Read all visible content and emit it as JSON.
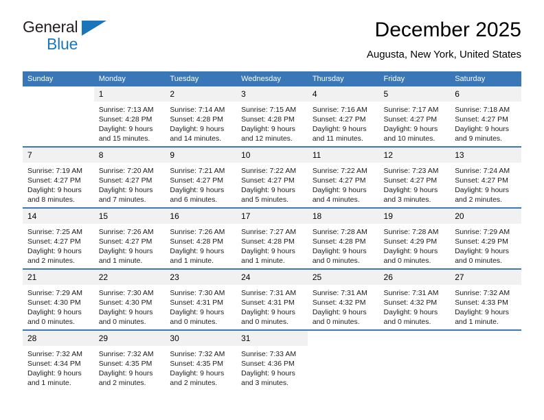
{
  "brand": {
    "line1": "General",
    "line2": "Blue",
    "triangle_color": "#1b75bb"
  },
  "header": {
    "title": "December 2025",
    "subtitle": "Augusta, New York, United States"
  },
  "theme": {
    "header_blue": "#3a77b8",
    "daynum_band": "#f1f1f1",
    "text": "#000000"
  },
  "calendar": {
    "weekday_headers": [
      "Sunday",
      "Monday",
      "Tuesday",
      "Wednesday",
      "Thursday",
      "Friday",
      "Saturday"
    ],
    "weeks": [
      [
        {
          "day": "",
          "lines": []
        },
        {
          "day": "1",
          "lines": [
            "Sunrise: 7:13 AM",
            "Sunset: 4:28 PM",
            "Daylight: 9 hours",
            "and 15 minutes."
          ]
        },
        {
          "day": "2",
          "lines": [
            "Sunrise: 7:14 AM",
            "Sunset: 4:28 PM",
            "Daylight: 9 hours",
            "and 14 minutes."
          ]
        },
        {
          "day": "3",
          "lines": [
            "Sunrise: 7:15 AM",
            "Sunset: 4:28 PM",
            "Daylight: 9 hours",
            "and 12 minutes."
          ]
        },
        {
          "day": "4",
          "lines": [
            "Sunrise: 7:16 AM",
            "Sunset: 4:27 PM",
            "Daylight: 9 hours",
            "and 11 minutes."
          ]
        },
        {
          "day": "5",
          "lines": [
            "Sunrise: 7:17 AM",
            "Sunset: 4:27 PM",
            "Daylight: 9 hours",
            "and 10 minutes."
          ]
        },
        {
          "day": "6",
          "lines": [
            "Sunrise: 7:18 AM",
            "Sunset: 4:27 PM",
            "Daylight: 9 hours",
            "and 9 minutes."
          ]
        }
      ],
      [
        {
          "day": "7",
          "lines": [
            "Sunrise: 7:19 AM",
            "Sunset: 4:27 PM",
            "Daylight: 9 hours",
            "and 8 minutes."
          ]
        },
        {
          "day": "8",
          "lines": [
            "Sunrise: 7:20 AM",
            "Sunset: 4:27 PM",
            "Daylight: 9 hours",
            "and 7 minutes."
          ]
        },
        {
          "day": "9",
          "lines": [
            "Sunrise: 7:21 AM",
            "Sunset: 4:27 PM",
            "Daylight: 9 hours",
            "and 6 minutes."
          ]
        },
        {
          "day": "10",
          "lines": [
            "Sunrise: 7:22 AM",
            "Sunset: 4:27 PM",
            "Daylight: 9 hours",
            "and 5 minutes."
          ]
        },
        {
          "day": "11",
          "lines": [
            "Sunrise: 7:22 AM",
            "Sunset: 4:27 PM",
            "Daylight: 9 hours",
            "and 4 minutes."
          ]
        },
        {
          "day": "12",
          "lines": [
            "Sunrise: 7:23 AM",
            "Sunset: 4:27 PM",
            "Daylight: 9 hours",
            "and 3 minutes."
          ]
        },
        {
          "day": "13",
          "lines": [
            "Sunrise: 7:24 AM",
            "Sunset: 4:27 PM",
            "Daylight: 9 hours",
            "and 2 minutes."
          ]
        }
      ],
      [
        {
          "day": "14",
          "lines": [
            "Sunrise: 7:25 AM",
            "Sunset: 4:27 PM",
            "Daylight: 9 hours",
            "and 2 minutes."
          ]
        },
        {
          "day": "15",
          "lines": [
            "Sunrise: 7:26 AM",
            "Sunset: 4:27 PM",
            "Daylight: 9 hours",
            "and 1 minute."
          ]
        },
        {
          "day": "16",
          "lines": [
            "Sunrise: 7:26 AM",
            "Sunset: 4:28 PM",
            "Daylight: 9 hours",
            "and 1 minute."
          ]
        },
        {
          "day": "17",
          "lines": [
            "Sunrise: 7:27 AM",
            "Sunset: 4:28 PM",
            "Daylight: 9 hours",
            "and 1 minute."
          ]
        },
        {
          "day": "18",
          "lines": [
            "Sunrise: 7:28 AM",
            "Sunset: 4:28 PM",
            "Daylight: 9 hours",
            "and 0 minutes."
          ]
        },
        {
          "day": "19",
          "lines": [
            "Sunrise: 7:28 AM",
            "Sunset: 4:29 PM",
            "Daylight: 9 hours",
            "and 0 minutes."
          ]
        },
        {
          "day": "20",
          "lines": [
            "Sunrise: 7:29 AM",
            "Sunset: 4:29 PM",
            "Daylight: 9 hours",
            "and 0 minutes."
          ]
        }
      ],
      [
        {
          "day": "21",
          "lines": [
            "Sunrise: 7:29 AM",
            "Sunset: 4:30 PM",
            "Daylight: 9 hours",
            "and 0 minutes."
          ]
        },
        {
          "day": "22",
          "lines": [
            "Sunrise: 7:30 AM",
            "Sunset: 4:30 PM",
            "Daylight: 9 hours",
            "and 0 minutes."
          ]
        },
        {
          "day": "23",
          "lines": [
            "Sunrise: 7:30 AM",
            "Sunset: 4:31 PM",
            "Daylight: 9 hours",
            "and 0 minutes."
          ]
        },
        {
          "day": "24",
          "lines": [
            "Sunrise: 7:31 AM",
            "Sunset: 4:31 PM",
            "Daylight: 9 hours",
            "and 0 minutes."
          ]
        },
        {
          "day": "25",
          "lines": [
            "Sunrise: 7:31 AM",
            "Sunset: 4:32 PM",
            "Daylight: 9 hours",
            "and 0 minutes."
          ]
        },
        {
          "day": "26",
          "lines": [
            "Sunrise: 7:31 AM",
            "Sunset: 4:32 PM",
            "Daylight: 9 hours",
            "and 0 minutes."
          ]
        },
        {
          "day": "27",
          "lines": [
            "Sunrise: 7:32 AM",
            "Sunset: 4:33 PM",
            "Daylight: 9 hours",
            "and 1 minute."
          ]
        }
      ],
      [
        {
          "day": "28",
          "lines": [
            "Sunrise: 7:32 AM",
            "Sunset: 4:34 PM",
            "Daylight: 9 hours",
            "and 1 minute."
          ]
        },
        {
          "day": "29",
          "lines": [
            "Sunrise: 7:32 AM",
            "Sunset: 4:35 PM",
            "Daylight: 9 hours",
            "and 2 minutes."
          ]
        },
        {
          "day": "30",
          "lines": [
            "Sunrise: 7:32 AM",
            "Sunset: 4:35 PM",
            "Daylight: 9 hours",
            "and 2 minutes."
          ]
        },
        {
          "day": "31",
          "lines": [
            "Sunrise: 7:33 AM",
            "Sunset: 4:36 PM",
            "Daylight: 9 hours",
            "and 3 minutes."
          ]
        },
        {
          "day": "",
          "lines": []
        },
        {
          "day": "",
          "lines": []
        },
        {
          "day": "",
          "lines": []
        }
      ]
    ]
  }
}
